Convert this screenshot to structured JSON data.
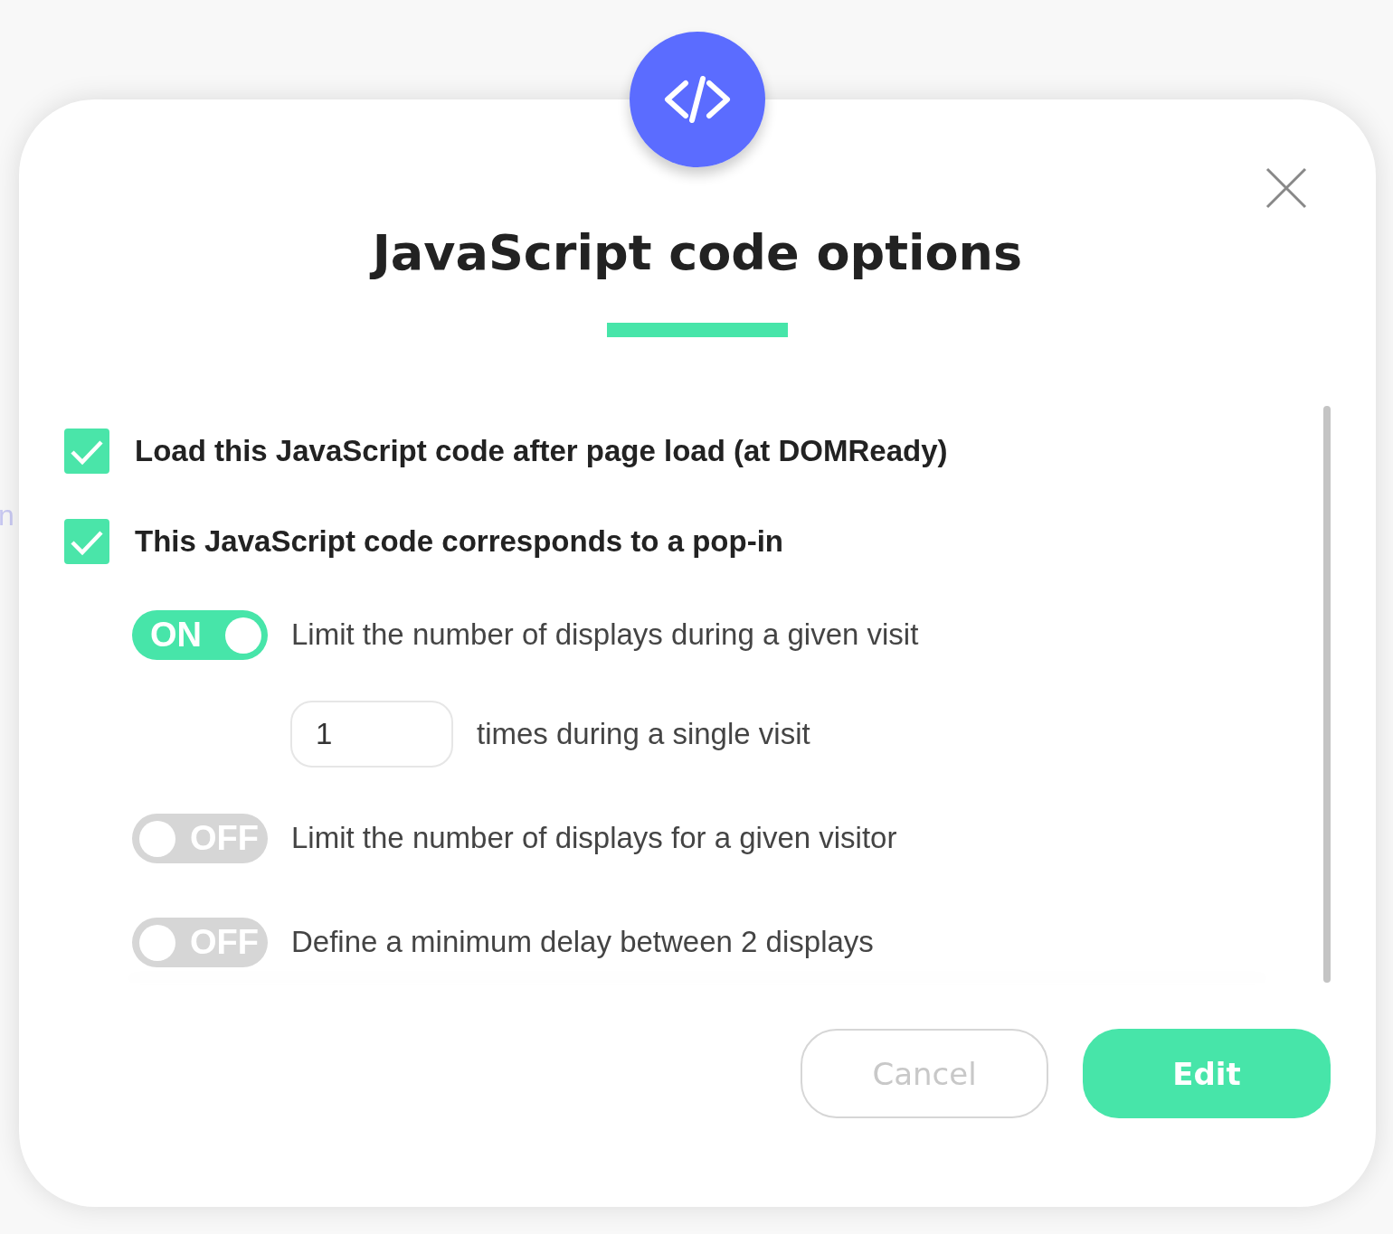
{
  "background_fragment": "n",
  "dialog": {
    "title": "JavaScript code options"
  },
  "checkboxes": [
    {
      "label": "Load this JavaScript code after page load (at DOMReady)",
      "checked": true
    },
    {
      "label": "This JavaScript code corresponds to a pop-in",
      "checked": true
    }
  ],
  "options": [
    {
      "kind": "toggle",
      "on": true,
      "state_label": "ON",
      "label": "Limit the number of displays during a given visit",
      "count": {
        "value": "1",
        "label": "times during a single visit"
      }
    },
    {
      "kind": "toggle",
      "on": false,
      "state_label": "OFF",
      "label": "Limit the number of displays for a given visitor"
    },
    {
      "kind": "toggle",
      "on": false,
      "state_label": "OFF",
      "label": "Define a minimum delay between 2 displays"
    }
  ],
  "buttons": [
    {
      "label": "Cancel",
      "kind": "secondary"
    },
    {
      "label": "Edit",
      "kind": "primary"
    }
  ]
}
